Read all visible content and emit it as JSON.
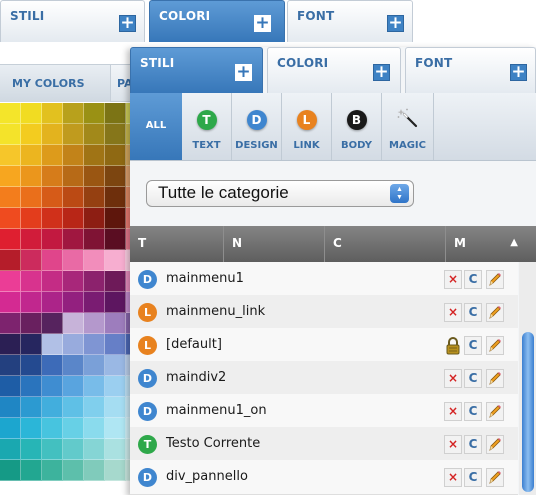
{
  "back_panel": {
    "tabs": [
      {
        "label": "STILI"
      },
      {
        "label": "COLORI"
      },
      {
        "label": "FONT"
      }
    ],
    "subtabs": {
      "my_colors": "MY COLORS",
      "palette_partial": "PA"
    },
    "swatches": [
      [
        "#f4e52a",
        "#f1dc22",
        "#e2c11f",
        "#b8a11c",
        "#9a9114",
        "#7c7415",
        "#cfcf5a"
      ],
      [
        "#f4e32a",
        "#f3cc1f",
        "#e3b31e",
        "#c09b1e",
        "#a2891a",
        "#86761a",
        "#c8b94e"
      ],
      [
        "#f6c62a",
        "#ecb51f",
        "#dd9b1b",
        "#c28319",
        "#a07415",
        "#8f6913",
        "#d5a85e"
      ],
      [
        "#f7a61f",
        "#eb961c",
        "#d67c1a",
        "#b76a17",
        "#9a5612",
        "#7c4510",
        "#e0a26e"
      ],
      [
        "#f37d1c",
        "#ea6f1b",
        "#d65b18",
        "#bb4a14",
        "#954011",
        "#6e2f0c",
        "#e38c66"
      ],
      [
        "#ef4b1f",
        "#e33d1c",
        "#d0301a",
        "#b82617",
        "#8d1e13",
        "#5e160c",
        "#ec7c72"
      ],
      [
        "#df1f30",
        "#d11c3a",
        "#c21940",
        "#a01740",
        "#7f1334",
        "#5a0d22",
        "#e8798e"
      ],
      [
        "#b51d2a",
        "#cc2b5d",
        "#e0458b",
        "#e96aa5",
        "#f28dbb",
        "#f7aed0",
        "#fbd0e3"
      ],
      [
        "#eb3d96",
        "#d8338e",
        "#c42c85",
        "#a8277a",
        "#8c226d",
        "#6e1a59",
        "#ea8fc0"
      ],
      [
        "#d42a92",
        "#c1278e",
        "#ac2489",
        "#93207f",
        "#7a1c72",
        "#5d1660",
        "#c48dd0"
      ],
      [
        "#7d236e",
        "#69205f",
        "#56235e",
        "#c7b3d9",
        "#b498cc",
        "#9d7dbd",
        "#8866ad"
      ],
      [
        "#2b1f54",
        "#26265f",
        "#b1c0e6",
        "#98abdd",
        "#7f95d3",
        "#667fc7",
        "#4e6ab9"
      ],
      [
        "#23407f",
        "#244a90",
        "#3d6bb8",
        "#5a86c9",
        "#7aa0d8",
        "#9ab8e4",
        "#bcd1ee"
      ],
      [
        "#1e5da6",
        "#2a74bd",
        "#3f8dd1",
        "#59a4df",
        "#78bce9",
        "#9bcff0",
        "#c0e2f6"
      ],
      [
        "#1f86c4",
        "#2c9ad1",
        "#42aedd",
        "#5fc0e6",
        "#80cfed",
        "#a5ddf2",
        "#cbebf8"
      ],
      [
        "#1ca6cf",
        "#2bb6d8",
        "#47c4df",
        "#67d0e6",
        "#8adbed",
        "#afe6f3",
        "#d3f1f8"
      ],
      [
        "#1aa8b0",
        "#27b5b6",
        "#43c0c0",
        "#62cacb",
        "#85d5d5",
        "#aae1e1",
        "#cfeeee"
      ],
      [
        "#159a86",
        "#22a791",
        "#3db39d",
        "#5dbfab",
        "#80cbbb",
        "#a6d9cd",
        "#cceae2"
      ]
    ]
  },
  "front_panel": {
    "tabs": [
      {
        "label": "STILI",
        "active": true
      },
      {
        "label": "COLORI",
        "active": false
      },
      {
        "label": "FONT",
        "active": false
      }
    ],
    "filters": [
      {
        "label": "ALL",
        "letter": "",
        "color": "",
        "active": true
      },
      {
        "label": "TEXT",
        "letter": "T",
        "color": "#2ea84a"
      },
      {
        "label": "DESIGN",
        "letter": "D",
        "color": "#3f86cf"
      },
      {
        "label": "LINK",
        "letter": "L",
        "color": "#e8821f"
      },
      {
        "label": "BODY",
        "letter": "B",
        "color": "#1a1a1a"
      },
      {
        "label": "MAGIC",
        "icon": "magic-wand-icon"
      }
    ],
    "category_select": {
      "value": "Tutte le categorie"
    },
    "columns": [
      {
        "label": "T"
      },
      {
        "label": "N"
      },
      {
        "label": "C"
      },
      {
        "label": "M"
      }
    ],
    "rows": [
      {
        "type": "D",
        "color": "#3f86cf",
        "name": "mainmenu1",
        "locked": false
      },
      {
        "type": "L",
        "color": "#e8821f",
        "name": "mainmenu_link",
        "locked": false
      },
      {
        "type": "L",
        "color": "#e8821f",
        "name": "[default]",
        "locked": true
      },
      {
        "type": "D",
        "color": "#3f86cf",
        "name": "maindiv2",
        "locked": false
      },
      {
        "type": "D",
        "color": "#3f86cf",
        "name": "mainmenu1_on",
        "locked": false
      },
      {
        "type": "T",
        "color": "#2ea84a",
        "name": "Testo Corrente",
        "locked": false
      },
      {
        "type": "D",
        "color": "#3f86cf",
        "name": "div_pannello",
        "locked": false
      }
    ],
    "action_glyphs": {
      "delete": "×",
      "copy": "C"
    }
  }
}
